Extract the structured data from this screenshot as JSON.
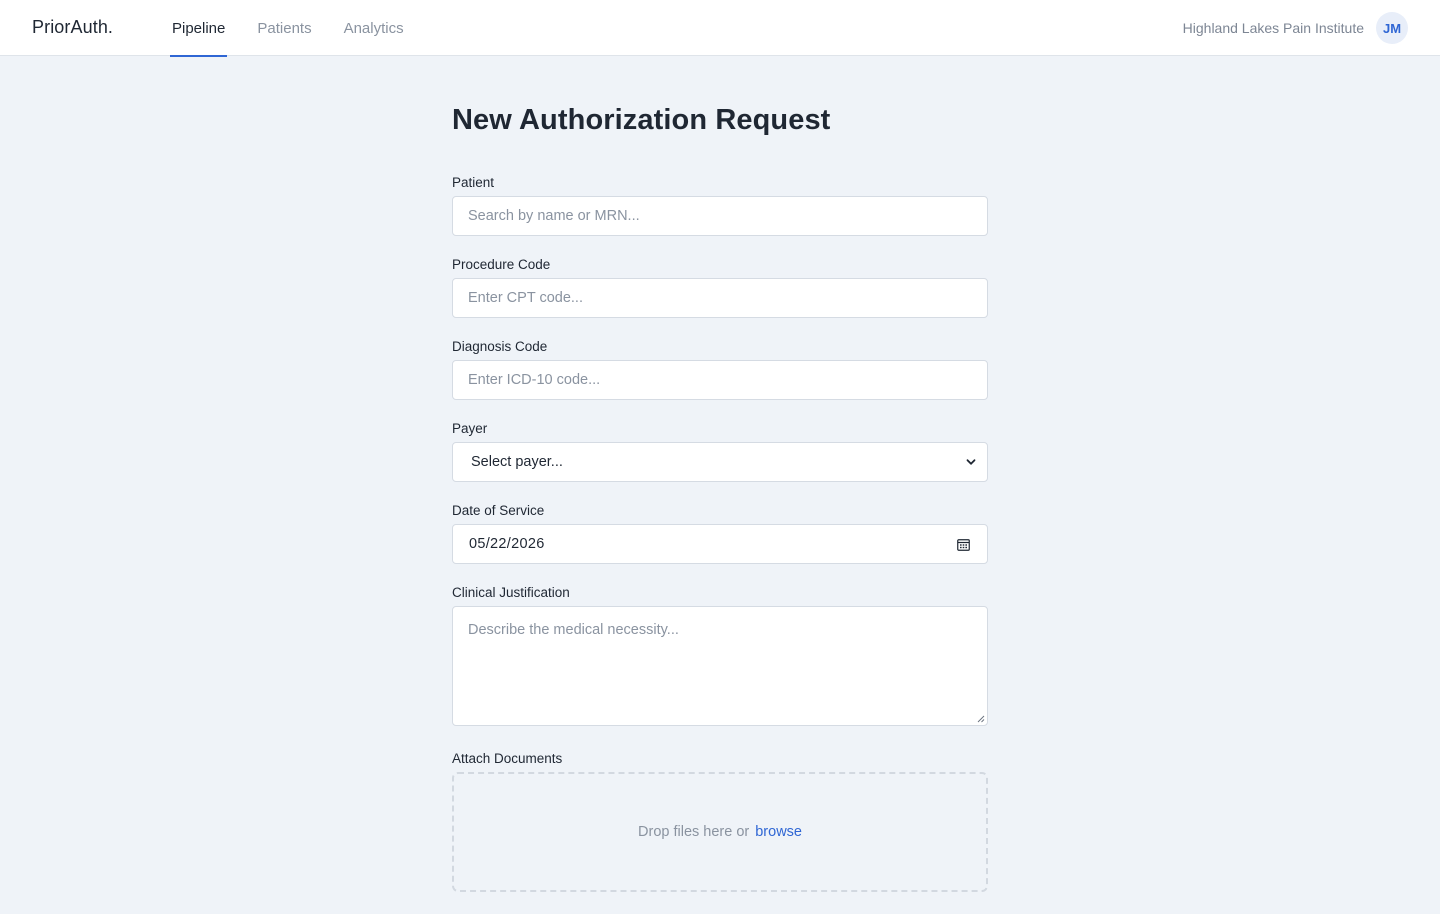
{
  "app": {
    "logo": "PriorAuth."
  },
  "nav": {
    "tabs": [
      {
        "label": "Pipeline",
        "active": true
      },
      {
        "label": "Patients"
      },
      {
        "label": "Analytics"
      }
    ]
  },
  "header": {
    "org_name": "Highland Lakes Pain Institute",
    "avatar_initials": "JM"
  },
  "form": {
    "title": "New Authorization Request",
    "patient": {
      "label": "Patient",
      "placeholder": "Search by name or MRN..."
    },
    "procedure_code": {
      "label": "Procedure Code",
      "placeholder": "Enter CPT code..."
    },
    "diagnosis_code": {
      "label": "Diagnosis Code",
      "placeholder": "Enter ICD-10 code..."
    },
    "payer": {
      "label": "Payer",
      "selected": "Select payer..."
    },
    "date_of_service": {
      "label": "Date of Service",
      "value": "05/22/2026"
    },
    "clinical_justification": {
      "label": "Clinical Justification",
      "placeholder": "Describe the medical necessity..."
    },
    "attach_documents": {
      "label": "Attach Documents",
      "drop_text": "Drop files here or",
      "browse_label": "browse"
    }
  },
  "colors": {
    "accent": "#2f66d4",
    "background": "#eff3f8",
    "muted_text": "#8a93a0"
  },
  "icons": {
    "payer_select": "chevron-down-icon",
    "date_picker": "calendar-icon",
    "textarea_resize": "resize-grip-icon"
  }
}
